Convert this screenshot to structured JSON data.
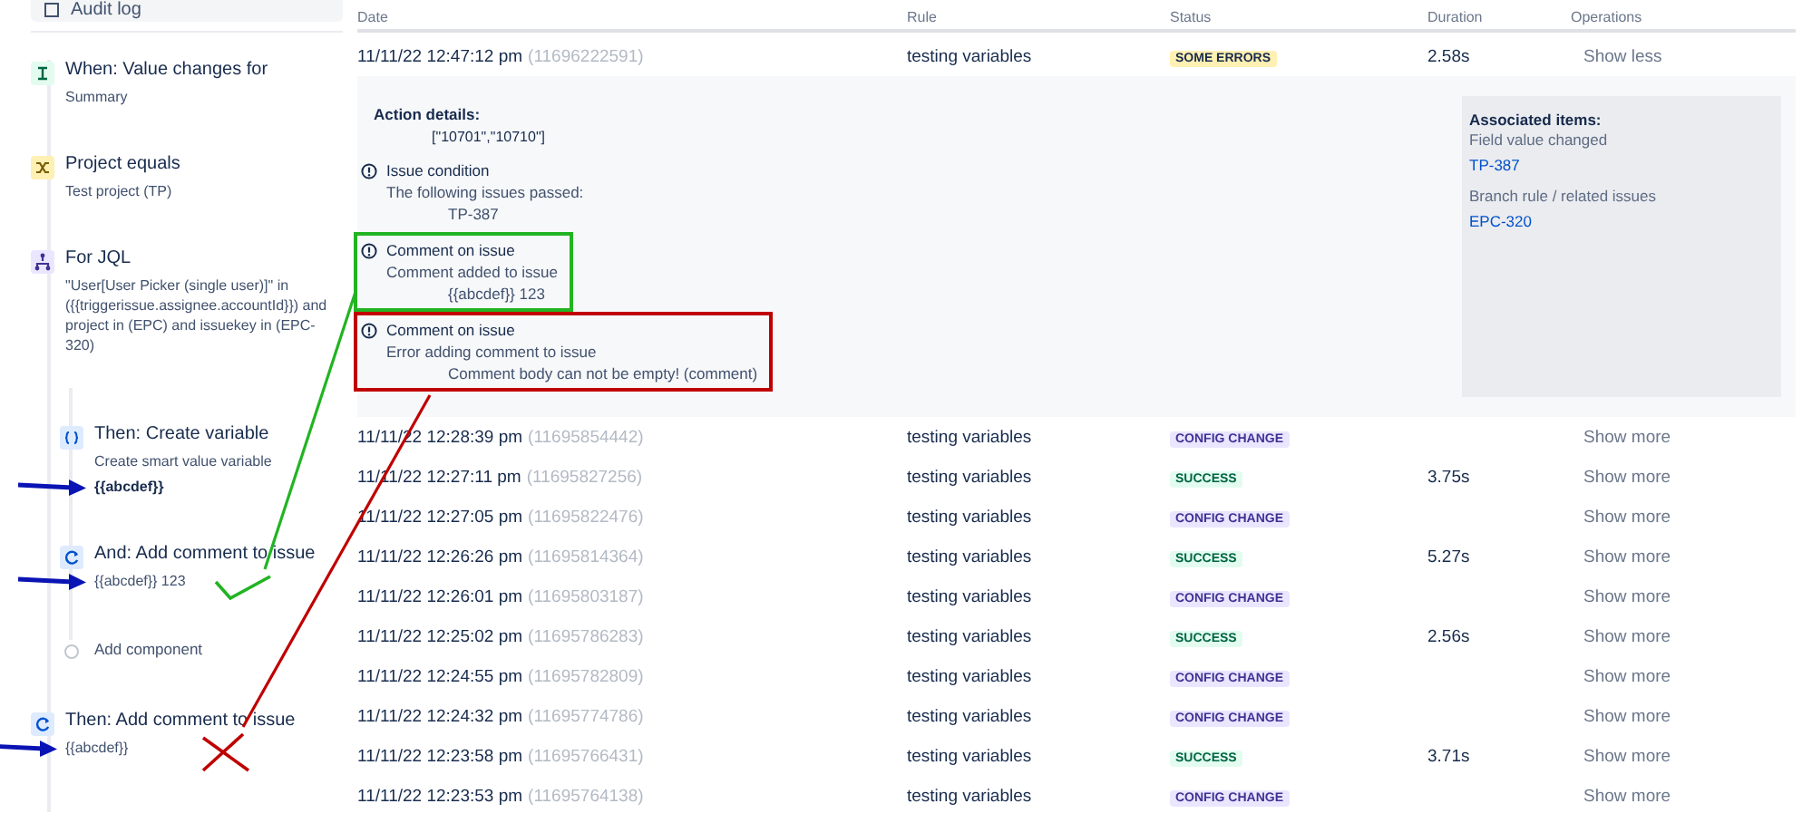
{
  "sidebar": {
    "top_item": {
      "label": "Audit log"
    },
    "steps": [
      {
        "kind": "trigger",
        "title": "When: Value changes for",
        "description": "Summary",
        "arrow": false,
        "check": false,
        "cross": false
      },
      {
        "kind": "condition",
        "title": "Project equals",
        "description": "Test project (TP)",
        "arrow": false,
        "check": false,
        "cross": false
      },
      {
        "kind": "branch",
        "title": "For JQL",
        "description": "\"User[User Picker (single user)]\" in ({{triggerissue.assignee.accountId}}) and project in (EPC) and issuekey in (EPC-320)",
        "arrow": false,
        "check": false,
        "cross": false,
        "children": [
          {
            "kind": "variable",
            "title": "Then: Create variable",
            "description": "Create smart value variable",
            "value": "{{abcdef}}",
            "emphasized": true,
            "arrow": true,
            "check": false,
            "cross": false
          },
          {
            "kind": "action",
            "title": "And: Add comment to issue",
            "value": "{{abcdef}} 123",
            "emphasized": false,
            "arrow": true,
            "check": true,
            "cross": false
          },
          {
            "kind": "add",
            "title": "Add component",
            "arrow": false,
            "check": false,
            "cross": false
          }
        ]
      },
      {
        "kind": "action",
        "title": "Then: Add comment to issue",
        "value": "{{abcdef}}",
        "emphasized": false,
        "arrow": true,
        "check": false,
        "cross": true
      }
    ]
  },
  "table": {
    "columns": [
      "Date",
      "Rule",
      "Status",
      "Duration",
      "Operations"
    ],
    "rows": [
      {
        "date": "11/11/22 12:47:12 pm",
        "id": "(11696222591)",
        "rule": "testing variables",
        "status": {
          "kind": "error",
          "label": "SOME ERRORS"
        },
        "duration": "2.58s",
        "operation": "Show less",
        "expanded": true,
        "details": {
          "heading": "Action details:",
          "value": "[\"10701\",\"10710\"]",
          "entries": [
            {
              "title": "Issue condition",
              "description": "The following issues passed:",
              "value": "TP-387"
            },
            {
              "title": "Comment on issue",
              "description": "Comment added to issue",
              "value": "{{abcdef}} 123",
              "color": "#22b422"
            },
            {
              "title": "Comment on issue",
              "description": "Error adding comment to issue",
              "value": "Comment body can not be empty! (comment)",
              "color": "#c00000"
            }
          ],
          "associated": {
            "title": "Associated items:",
            "groups": [
              {
                "label": "Field value changed",
                "link": "TP-387"
              },
              {
                "label": "Branch rule / related issues",
                "link": "EPC-320"
              }
            ]
          }
        }
      },
      {
        "date": "11/11/22 12:28:39 pm",
        "id": "(11695854442)",
        "rule": "testing variables",
        "status": {
          "kind": "config",
          "label": "CONFIG CHANGE"
        },
        "duration": "",
        "operation": "Show more",
        "expanded": false
      },
      {
        "date": "11/11/22 12:27:11 pm",
        "id": "(11695827256)",
        "rule": "testing variables",
        "status": {
          "kind": "success",
          "label": "SUCCESS"
        },
        "duration": "3.75s",
        "operation": "Show more",
        "expanded": false
      },
      {
        "date": "11/11/22 12:27:05 pm",
        "id": "(11695822476)",
        "rule": "testing variables",
        "status": {
          "kind": "config",
          "label": "CONFIG CHANGE"
        },
        "duration": "",
        "operation": "Show more",
        "expanded": false
      },
      {
        "date": "11/11/22 12:26:26 pm",
        "id": "(11695814364)",
        "rule": "testing variables",
        "status": {
          "kind": "success",
          "label": "SUCCESS"
        },
        "duration": "5.27s",
        "operation": "Show more",
        "expanded": false
      },
      {
        "date": "11/11/22 12:26:01 pm",
        "id": "(11695803187)",
        "rule": "testing variables",
        "status": {
          "kind": "config",
          "label": "CONFIG CHANGE"
        },
        "duration": "",
        "operation": "Show more",
        "expanded": false
      },
      {
        "date": "11/11/22 12:25:02 pm",
        "id": "(11695786283)",
        "rule": "testing variables",
        "status": {
          "kind": "success",
          "label": "SUCCESS"
        },
        "duration": "2.56s",
        "operation": "Show more",
        "expanded": false
      },
      {
        "date": "11/11/22 12:24:55 pm",
        "id": "(11695782809)",
        "rule": "testing variables",
        "status": {
          "kind": "config",
          "label": "CONFIG CHANGE"
        },
        "duration": "",
        "operation": "Show more",
        "expanded": false
      },
      {
        "date": "11/11/22 12:24:32 pm",
        "id": "(11695774786)",
        "rule": "testing variables",
        "status": {
          "kind": "config",
          "label": "CONFIG CHANGE"
        },
        "duration": "",
        "operation": "Show more",
        "expanded": false
      },
      {
        "date": "11/11/22 12:23:58 pm",
        "id": "(11695766431)",
        "rule": "testing variables",
        "status": {
          "kind": "success",
          "label": "SUCCESS"
        },
        "duration": "3.71s",
        "operation": "Show more",
        "expanded": false
      },
      {
        "date": "11/11/22 12:23:53 pm",
        "id": "(11695764138)",
        "rule": "testing variables",
        "status": {
          "kind": "config",
          "label": "CONFIG CHANGE"
        },
        "duration": "",
        "operation": "Show more",
        "expanded": false
      }
    ]
  }
}
